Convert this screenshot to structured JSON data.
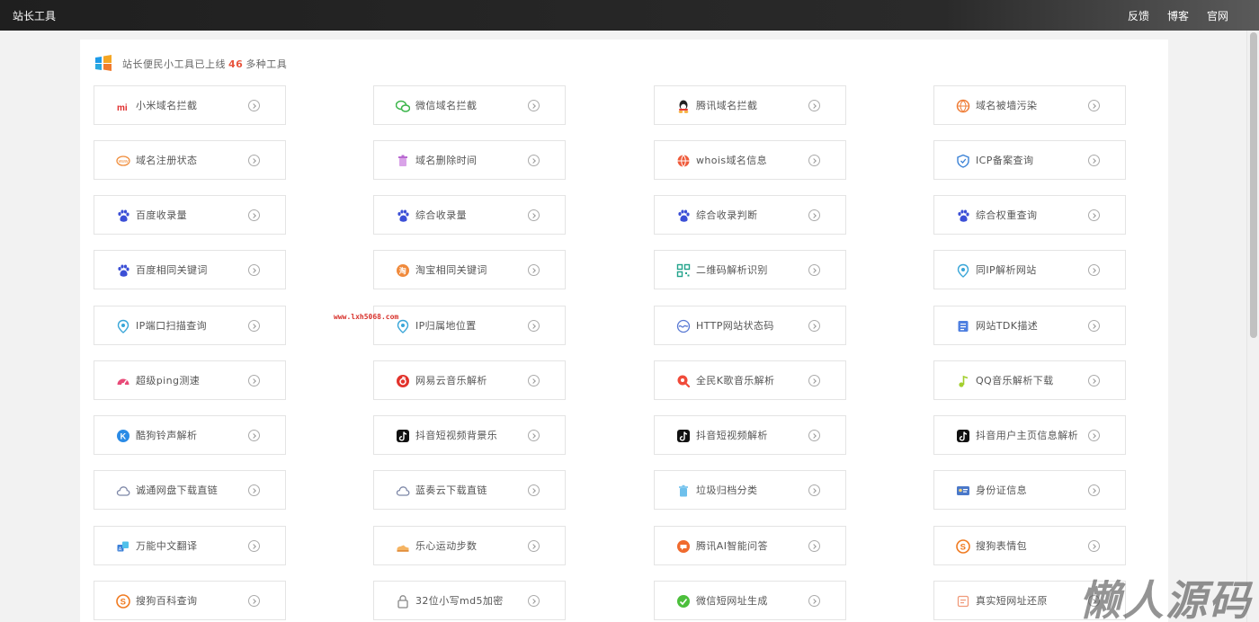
{
  "topbar": {
    "brand": "站长工具",
    "nav": [
      "反馈",
      "博客",
      "官网"
    ]
  },
  "header": {
    "prefix": "站长便民小工具已上线",
    "count": "46",
    "suffix": "多种工具"
  },
  "colors": {
    "topbar": "#222222",
    "page_bg": "#f2f2f2",
    "panel_bg": "#ffffff",
    "tile_border": "#e4e4e4",
    "count_accent": "#e8563f"
  },
  "tools": [
    [
      {
        "label": "小米域名拦截",
        "icon": "xiaomi-icon"
      },
      {
        "label": "微信域名拦截",
        "icon": "wechat-icon"
      },
      {
        "label": "腾讯域名拦截",
        "icon": "qq-penguin-icon"
      },
      {
        "label": "域名被墙污染",
        "icon": "globe-blocked-icon"
      }
    ],
    [
      {
        "label": "域名注册状态",
        "icon": "www-icon"
      },
      {
        "label": "域名删除时间",
        "icon": "trash-icon"
      },
      {
        "label": "whois域名信息",
        "icon": "globe-icon"
      },
      {
        "label": "ICP备案查询",
        "icon": "shield-icon"
      }
    ],
    [
      {
        "label": "百度收录量",
        "icon": "baidu-paw-icon"
      },
      {
        "label": "综合收录量",
        "icon": "baidu-paw-icon"
      },
      {
        "label": "综合收录判断",
        "icon": "baidu-paw-icon"
      },
      {
        "label": "综合权重查询",
        "icon": "baidu-paw-icon"
      }
    ],
    [
      {
        "label": "百度相同关键词",
        "icon": "baidu-paw-icon"
      },
      {
        "label": "淘宝相同关键词",
        "icon": "taobao-icon"
      },
      {
        "label": "二维码解析识别",
        "icon": "qrcode-icon"
      },
      {
        "label": "同IP解析网站",
        "icon": "location-pin-icon"
      }
    ],
    [
      {
        "label": "IP端口扫描查询",
        "icon": "location-pin-icon"
      },
      {
        "label": "IP归属地位置",
        "icon": "location-pin-icon"
      },
      {
        "label": "HTTP网站状态码",
        "icon": "wave-icon"
      },
      {
        "label": "网站TDK描述",
        "icon": "document-icon"
      }
    ],
    [
      {
        "label": "超级ping测速",
        "icon": "speedometer-icon"
      },
      {
        "label": "网易云音乐解析",
        "icon": "netease-music-icon"
      },
      {
        "label": "全民K歌音乐解析",
        "icon": "karaoke-icon"
      },
      {
        "label": "QQ音乐解析下载",
        "icon": "music-note-icon"
      }
    ],
    [
      {
        "label": "酷狗铃声解析",
        "icon": "kugou-icon"
      },
      {
        "label": "抖音短视频背景乐",
        "icon": "tiktok-icon"
      },
      {
        "label": "抖音短视频解析",
        "icon": "tiktok-icon"
      },
      {
        "label": "抖音用户主页信息解析",
        "icon": "tiktok-icon"
      }
    ],
    [
      {
        "label": "诚通网盘下载直链",
        "icon": "cloud-icon"
      },
      {
        "label": "蓝奏云下载直链",
        "icon": "cloud-icon"
      },
      {
        "label": "垃圾归档分类",
        "icon": "trash-bin-icon"
      },
      {
        "label": "身份证信息",
        "icon": "id-card-icon"
      }
    ],
    [
      {
        "label": "万能中文翻译",
        "icon": "translate-icon"
      },
      {
        "label": "乐心运动步数",
        "icon": "shoe-icon"
      },
      {
        "label": "腾讯AI智能问答",
        "icon": "ai-chat-icon"
      },
      {
        "label": "搜狗表情包",
        "icon": "sogou-icon"
      }
    ],
    [
      {
        "label": "搜狗百科查询",
        "icon": "sogou-icon"
      },
      {
        "label": "32位小写md5加密",
        "icon": "lock-icon"
      },
      {
        "label": "微信短网址生成",
        "icon": "wechat-green-icon"
      },
      {
        "label": "真实短网址还原",
        "icon": "link-icon"
      }
    ]
  ],
  "overlays": {
    "stamp": "www.lxh5068.com",
    "watermark": "懒人源码"
  }
}
